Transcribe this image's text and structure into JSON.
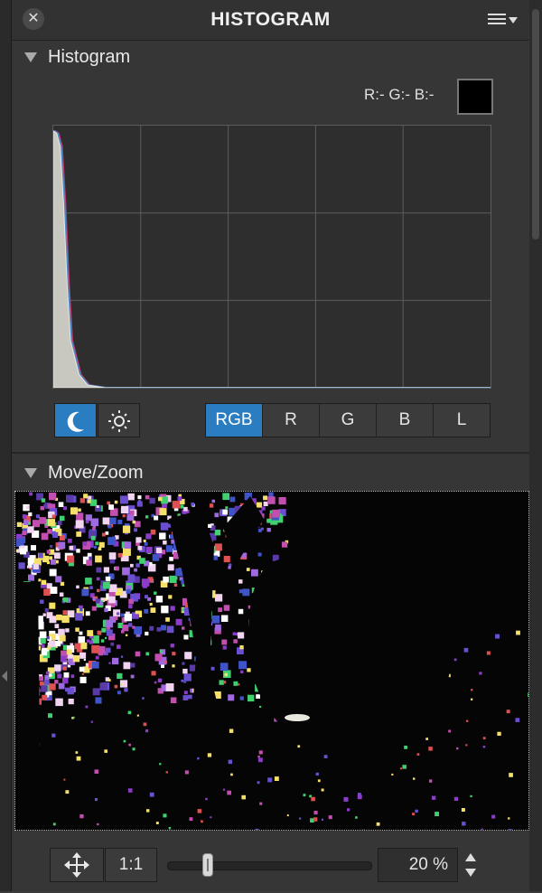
{
  "window": {
    "title": "HISTOGRAM",
    "close_icon": "close-icon",
    "menu_icon": "menu-list-icon"
  },
  "histogram_section": {
    "header": "Histogram",
    "readout": "R:- G:- B:-",
    "swatch_color": "#000000",
    "view_modes": [
      {
        "name": "night-mode-icon",
        "active": true
      },
      {
        "name": "day-mode-icon",
        "active": false
      }
    ],
    "channels": [
      "RGB",
      "R",
      "G",
      "B",
      "L"
    ],
    "active_channel": "RGB"
  },
  "chart_data": {
    "type": "area",
    "x": [
      0,
      2,
      4,
      6,
      8,
      10,
      15,
      20,
      30,
      50,
      100,
      150,
      200,
      255
    ],
    "values": [
      98,
      97,
      92,
      70,
      40,
      18,
      5,
      1,
      0,
      0,
      0,
      0,
      0,
      0
    ],
    "xlim": [
      0,
      255
    ],
    "ylim": [
      0,
      100
    ],
    "grid": true,
    "xlabel": "",
    "ylabel": ""
  },
  "move_zoom_section": {
    "header": "Move/Zoom"
  },
  "bottom_bar": {
    "move_icon": "move-arrows-icon",
    "ratio_label": "1:1",
    "zoom_value": "20 %",
    "zoom_percent": 20
  },
  "colors": {
    "accent": "#2b7dc2",
    "panel_bg": "#363636"
  }
}
